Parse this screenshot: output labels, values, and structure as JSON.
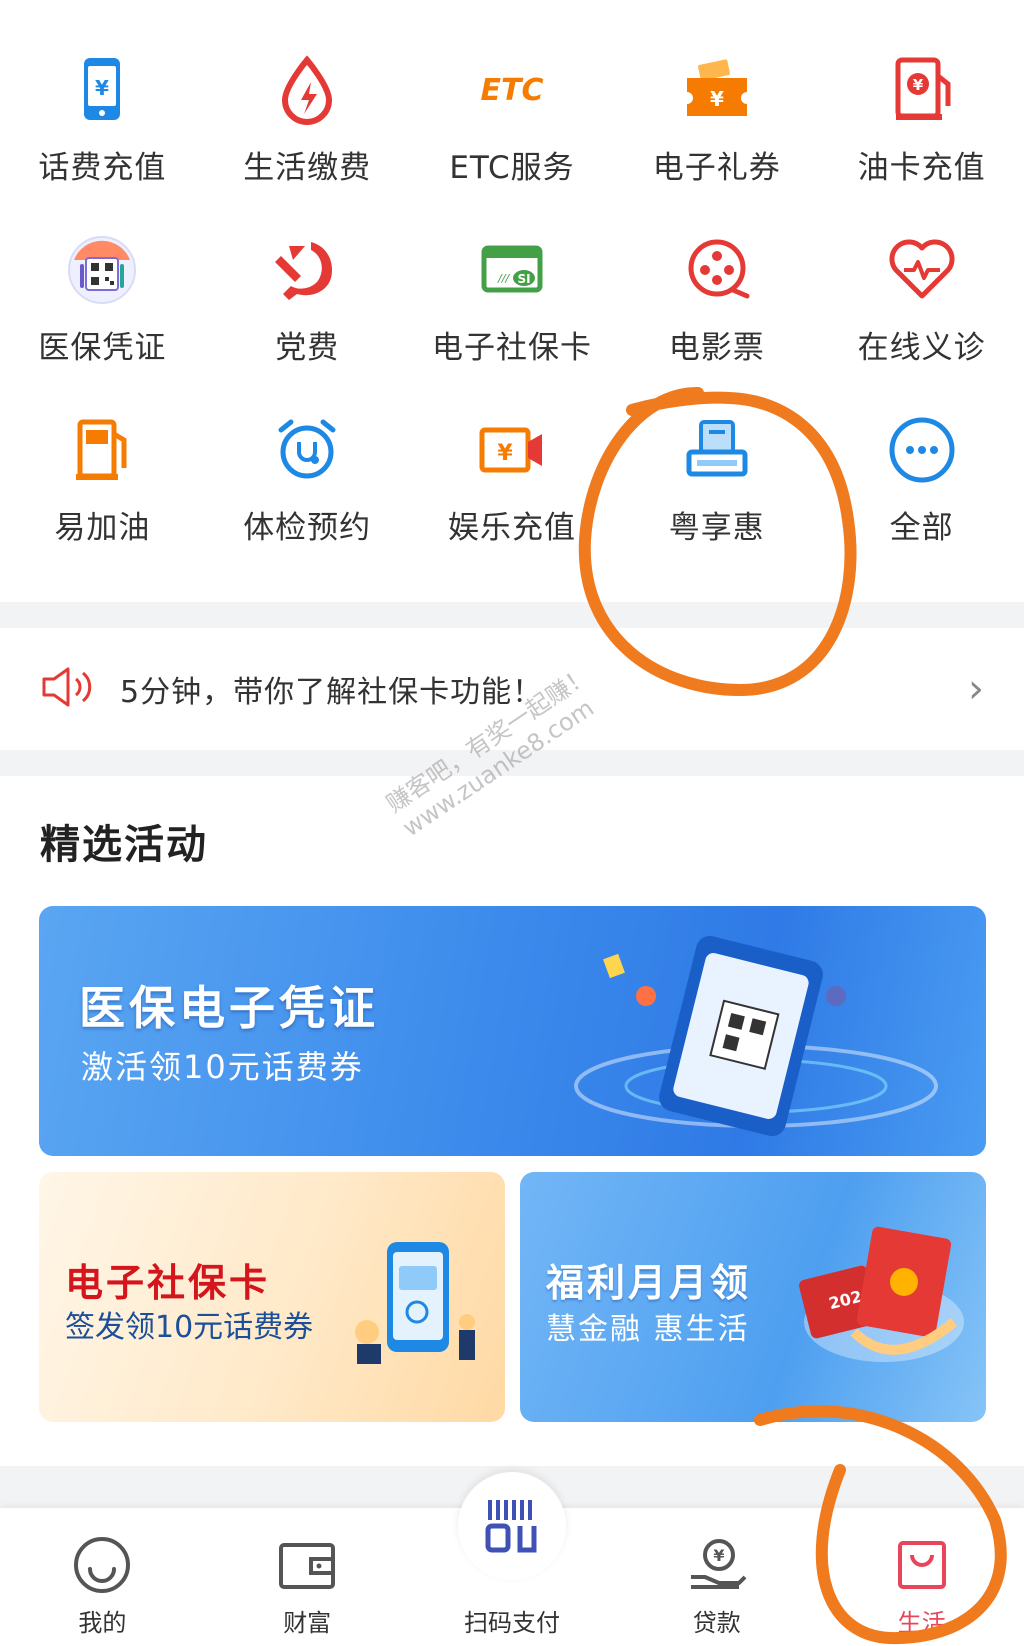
{
  "services": [
    {
      "label": "话费充值",
      "icon": "phone-recharge-icon",
      "color": "#1e88e5"
    },
    {
      "label": "生活缴费",
      "icon": "utility-payment-icon",
      "color": "#e53935"
    },
    {
      "label": "ETC服务",
      "icon": "etc-icon",
      "color": "#f57c00"
    },
    {
      "label": "电子礼券",
      "icon": "gift-voucher-icon",
      "color": "#f57c00"
    },
    {
      "label": "油卡充值",
      "icon": "fuel-card-icon",
      "color": "#e53935"
    },
    {
      "label": "医保凭证",
      "icon": "medical-insurance-qr-icon",
      "color": "#6a5acd"
    },
    {
      "label": "党费",
      "icon": "party-fee-icon",
      "color": "#e53935"
    },
    {
      "label": "电子社保卡",
      "icon": "social-security-card-icon",
      "color": "#43a047"
    },
    {
      "label": "电影票",
      "icon": "movie-ticket-icon",
      "color": "#e53935"
    },
    {
      "label": "在线义诊",
      "icon": "online-clinic-heart-icon",
      "color": "#e53935"
    },
    {
      "label": "易加油",
      "icon": "gas-station-icon",
      "color": "#f57c00"
    },
    {
      "label": "体检预约",
      "icon": "checkup-alarm-icon",
      "color": "#1e88e5"
    },
    {
      "label": "娱乐充值",
      "icon": "entertainment-recharge-icon",
      "color": "#f57c00"
    },
    {
      "label": "粤享惠",
      "icon": "yue-xiang-hui-icon",
      "color": "#1e88e5"
    },
    {
      "label": "全部",
      "icon": "more-dots-icon",
      "color": "#1e88e5"
    }
  ],
  "notice": {
    "text": "5分钟，带你了解社保卡功能！",
    "icon": "speaker-icon",
    "chevron": "›"
  },
  "activities": {
    "title": "精选活动",
    "banner_main": {
      "title": "医保电子凭证",
      "subtitle": "激活领10元话费券"
    },
    "banner_left": {
      "title": "电子社保卡",
      "subtitle": "签发领10元话费券"
    },
    "banner_right": {
      "title": "福利月月领",
      "subtitle": "慧金融  惠生活",
      "badge": "2021"
    }
  },
  "watermark": {
    "line1": "赚客吧，有奖一起赚！",
    "line2": "www.zuanke8.com"
  },
  "tabbar": [
    {
      "label": "我的",
      "icon": "profile-smile-icon"
    },
    {
      "label": "财富",
      "icon": "wallet-icon"
    },
    {
      "label": "扫码支付",
      "icon": "scan-pay-icon"
    },
    {
      "label": "贷款",
      "icon": "loan-icon"
    },
    {
      "label": "生活",
      "icon": "shopping-bag-icon",
      "active": true
    }
  ],
  "colors": {
    "primary_blue": "#1e88e5",
    "accent_red": "#e53935",
    "accent_orange": "#f57c00",
    "annotation_orange": "#f07a1e",
    "tab_active": "#e8455a"
  }
}
